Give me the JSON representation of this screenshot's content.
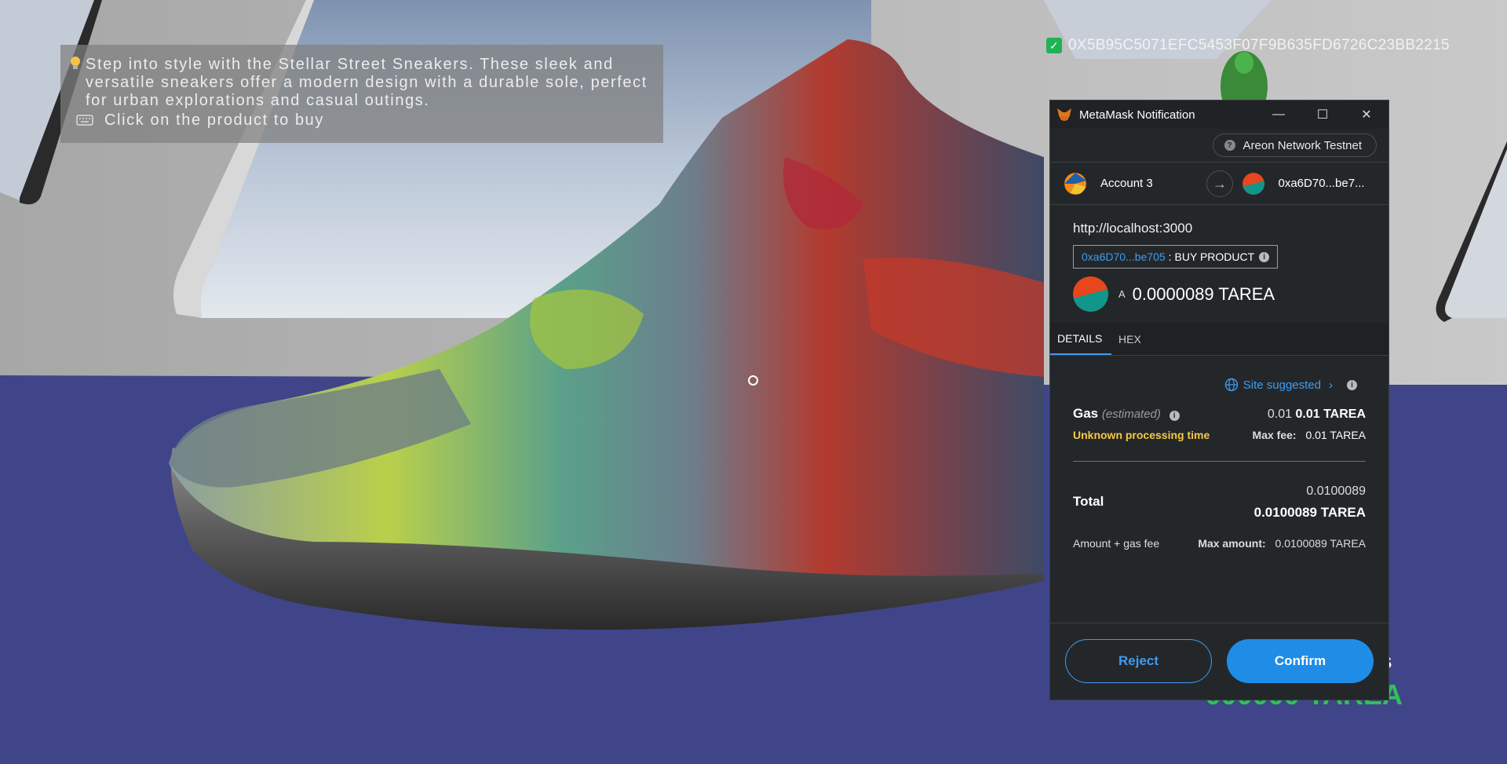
{
  "overlay": {
    "description": "Step into style with the Stellar Street Sneakers. These sleek and versatile sneakers offer a modern design with a durable sole, perfect for urban explorations and casual outings.",
    "hint": "Click on the product to buy"
  },
  "wallet": {
    "address": "0X5B95C5071EFC5453F07F9B635FD6726C23BB2215"
  },
  "product": {
    "name_fragment": "s",
    "price_fragment": "000000 TAREA"
  },
  "metamask": {
    "title": "MetaMask Notification",
    "network": "Areon Network Testnet",
    "from_account": "Account 3",
    "to_account": "0xa6D70...be7...",
    "origin": "http://localhost:3000",
    "contract_address": "0xa6D70...be705",
    "method": "BUY PRODUCT",
    "amount_symbol": "A",
    "amount": "0.0000089 TAREA",
    "tabs": [
      "DETAILS",
      "HEX"
    ],
    "site_suggested": "Site suggested",
    "gas_label": "Gas",
    "gas_estimated": "(estimated)",
    "gas_value_plain": "0.01",
    "gas_value_bold": "0.01 TAREA",
    "processing": "Unknown processing time",
    "max_fee_label": "Max fee:",
    "max_fee_value": "0.01 TAREA",
    "total_label": "Total",
    "total_small": "0.0100089",
    "total_big": "0.0100089 TAREA",
    "amount_gas_label": "Amount + gas fee",
    "max_amount_label": "Max amount:",
    "max_amount_value": "0.0100089 TAREA",
    "reject": "Reject",
    "confirm": "Confirm",
    "colors": {
      "accent": "#1f8de6",
      "warning": "#f7c844",
      "check": "#1fb352"
    }
  }
}
